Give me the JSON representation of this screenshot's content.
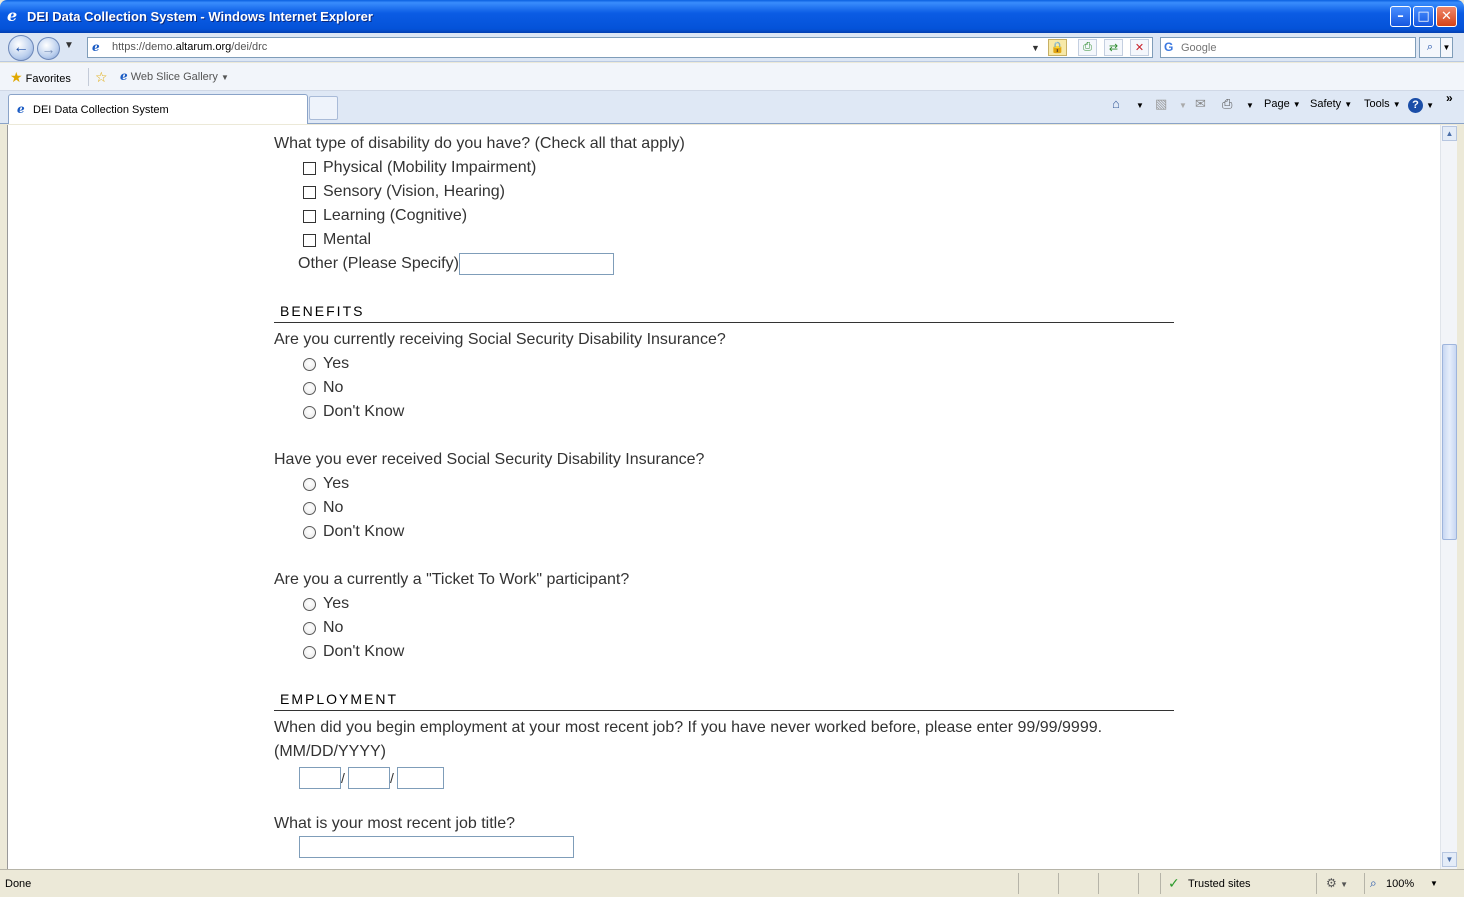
{
  "window": {
    "title": "DEI Data Collection System - Windows Internet Explorer",
    "min_glyph": "–",
    "max_glyph": "□",
    "close_glyph": "✕"
  },
  "address": {
    "url_prefix": "https://demo.",
    "url_domain": "altarum.org",
    "url_path": "/dei/drc"
  },
  "search": {
    "placeholder": "Google"
  },
  "favorites": {
    "favorites_label": "Favorites",
    "web_slice_label": "Web Slice Gallery"
  },
  "tab": {
    "label": "DEI Data Collection System"
  },
  "commands": {
    "page": "Page",
    "safety": "Safety",
    "tools": "Tools"
  },
  "form": {
    "disability": {
      "question": "What type of disability do you have? (Check all that apply)",
      "options": [
        "Physical (Mobility Impairment)",
        "Sensory (Vision, Hearing)",
        "Learning (Cognitive)",
        "Mental"
      ],
      "other_label": "Other (Please Specify)",
      "other_value": ""
    },
    "benefits": {
      "heading": "BENEFITS",
      "q1": {
        "question": "Are you currently receiving Social Security Disability Insurance?",
        "options": [
          "Yes",
          "No",
          "Don't Know"
        ]
      },
      "q2": {
        "question": "Have you ever received Social Security Disability Insurance?",
        "options": [
          "Yes",
          "No",
          "Don't Know"
        ]
      },
      "q3": {
        "question": "Are you a currently a \"Ticket To Work\" participant?",
        "options": [
          "Yes",
          "No",
          "Don't Know"
        ]
      }
    },
    "employment": {
      "heading": "EMPLOYMENT",
      "start_question": "When did you begin employment at your most recent job? If you have never worked before, please enter 99/99/9999.",
      "start_format": "(MM/DD/YYYY)",
      "date_separator": "/",
      "mm": "",
      "dd": "",
      "yyyy": "",
      "title_question": "What is your most recent job title?",
      "title_value": ""
    }
  },
  "status": {
    "text": "Done",
    "zone": "Trusted sites",
    "zoom": "100%"
  }
}
